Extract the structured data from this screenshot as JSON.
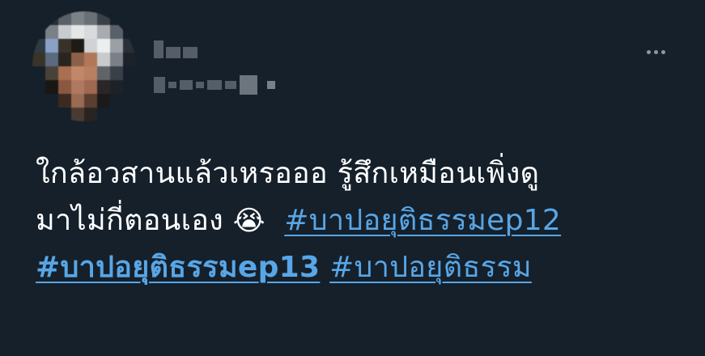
{
  "tweet": {
    "text_line1": "ใกล้อวสานแล้วเหรอออ รู้สึกเหมือนเพิ่งดู",
    "text_line2_plain": "มาไม่กี่ตอนเอง ",
    "emoji": "😭",
    "hashtags": [
      "#บาปอยุติธรรมep12",
      "#บาปอยุติธรรมep13",
      "#บาปอยุติธรรม"
    ],
    "more_icon": "more-horizontal-icon"
  },
  "colors": {
    "background": "#15202b",
    "text": "#ffffff",
    "link": "#58a6e6"
  }
}
